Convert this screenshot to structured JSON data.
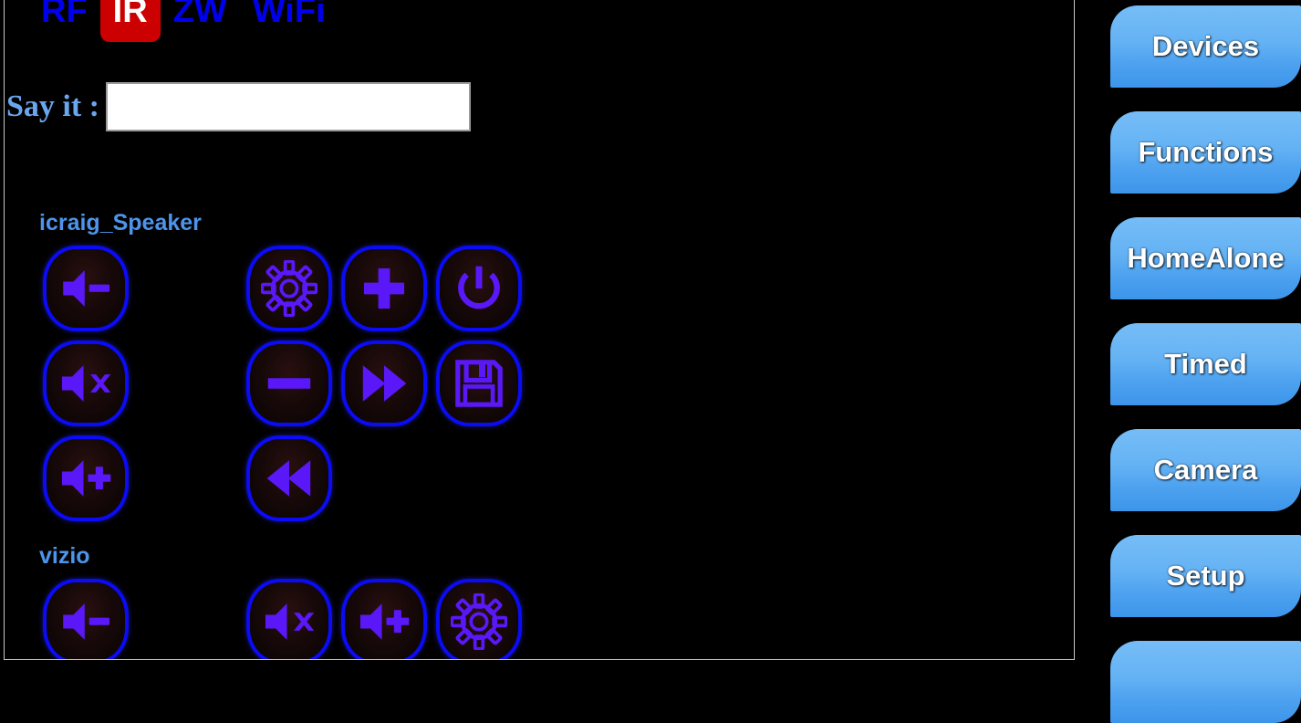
{
  "app": {
    "accent_blue": "#0000ee",
    "active_tab_bg": "#cc0000",
    "button_border": "#0b0bf5",
    "icon_color": "#5a18f8",
    "sidebar_button_top": "#76bdf7",
    "sidebar_button_bottom": "#3d95ea",
    "label_color": "#4d95eb"
  },
  "tabs": [
    {
      "label": "RF",
      "active": false
    },
    {
      "label": "IR",
      "active": true
    },
    {
      "label": "ZW",
      "active": false
    },
    {
      "label": "WiFi",
      "active": false
    }
  ],
  "sayit": {
    "label": "Say it :",
    "value": "",
    "placeholder": ""
  },
  "devices": [
    {
      "name": "icraig_Speaker",
      "buttons": [
        {
          "icon": "volume-down-icon",
          "row": 0,
          "col": 0
        },
        {
          "icon": "gear-icon",
          "row": 0,
          "col": 2
        },
        {
          "icon": "plus-icon",
          "row": 0,
          "col": 3
        },
        {
          "icon": "power-icon",
          "row": 0,
          "col": 4
        },
        {
          "icon": "volume-mute-icon",
          "row": 1,
          "col": 0
        },
        {
          "icon": "minus-icon",
          "row": 1,
          "col": 2
        },
        {
          "icon": "fast-forward-icon",
          "row": 1,
          "col": 3
        },
        {
          "icon": "save-icon",
          "row": 1,
          "col": 4
        },
        {
          "icon": "volume-up-icon",
          "row": 2,
          "col": 0
        },
        {
          "icon": "rewind-icon",
          "row": 2,
          "col": 2
        }
      ]
    },
    {
      "name": "vizio",
      "buttons": [
        {
          "icon": "volume-down-icon",
          "row": 0,
          "col": 0
        },
        {
          "icon": "volume-mute-icon",
          "row": 0,
          "col": 2
        },
        {
          "icon": "volume-up-icon",
          "row": 0,
          "col": 3
        },
        {
          "icon": "gear-icon",
          "row": 0,
          "col": 4
        }
      ]
    }
  ],
  "sidebar": {
    "items": [
      {
        "label": "Devices"
      },
      {
        "label": "Functions"
      },
      {
        "label": "HomeAlone"
      },
      {
        "label": "Timed"
      },
      {
        "label": "Camera"
      },
      {
        "label": "Setup"
      },
      {
        "label": ""
      }
    ]
  }
}
